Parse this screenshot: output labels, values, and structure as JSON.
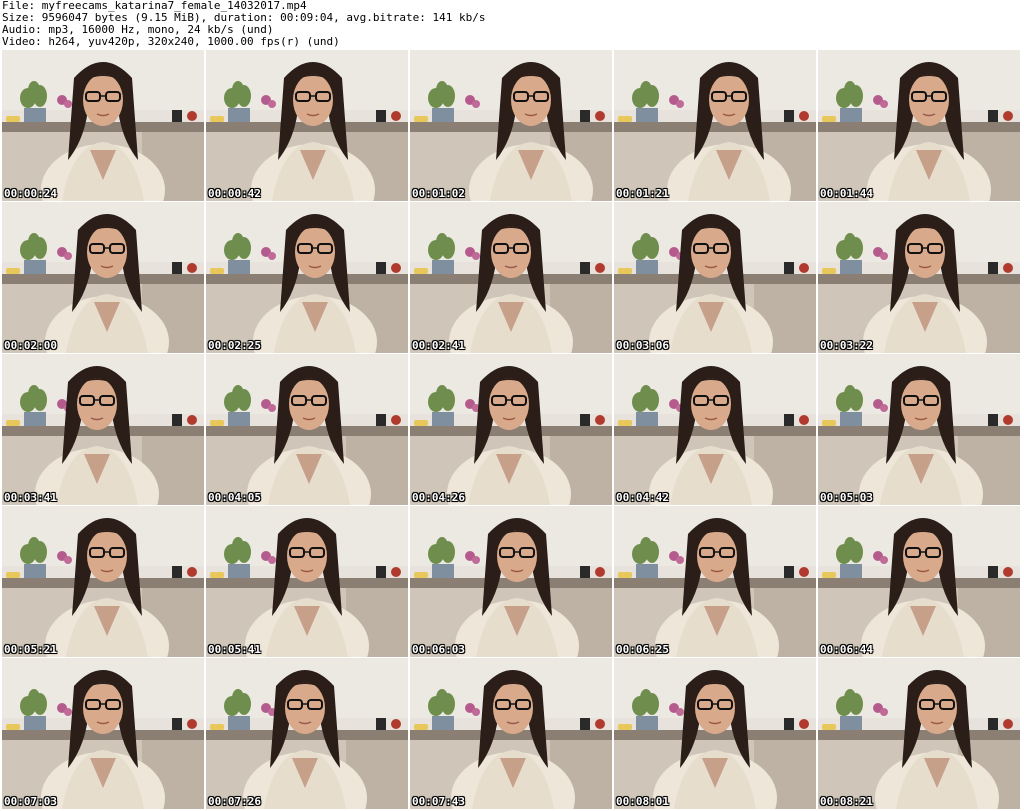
{
  "header": {
    "file_line": "File: myfreecams_katarina7_female_14032017.mp4",
    "size_line": "Size: 9596047 bytes (9.15 MiB), duration: 00:09:04, avg.bitrate: 141 kb/s",
    "audio_line": "Audio: mp3, 16000 Hz, mono, 24 kb/s (und)",
    "video_line": "Video: h264, yuv420p, 320x240, 1000.00 fps(r) (und)"
  },
  "thumbnails": [
    {
      "timestamp": "00:00:24"
    },
    {
      "timestamp": "00:00:42"
    },
    {
      "timestamp": "00:01:02"
    },
    {
      "timestamp": "00:01:21"
    },
    {
      "timestamp": "00:01:44"
    },
    {
      "timestamp": "00:02:00"
    },
    {
      "timestamp": "00:02:25"
    },
    {
      "timestamp": "00:02:41"
    },
    {
      "timestamp": "00:03:06"
    },
    {
      "timestamp": "00:03:22"
    },
    {
      "timestamp": "00:03:41"
    },
    {
      "timestamp": "00:04:05"
    },
    {
      "timestamp": "00:04:26"
    },
    {
      "timestamp": "00:04:42"
    },
    {
      "timestamp": "00:05:03"
    },
    {
      "timestamp": "00:05:21"
    },
    {
      "timestamp": "00:05:41"
    },
    {
      "timestamp": "00:06:03"
    },
    {
      "timestamp": "00:06:25"
    },
    {
      "timestamp": "00:06:44"
    },
    {
      "timestamp": "00:07:03"
    },
    {
      "timestamp": "00:07:26"
    },
    {
      "timestamp": "00:07:43"
    },
    {
      "timestamp": "00:08:01"
    },
    {
      "timestamp": "00:08:21"
    }
  ]
}
